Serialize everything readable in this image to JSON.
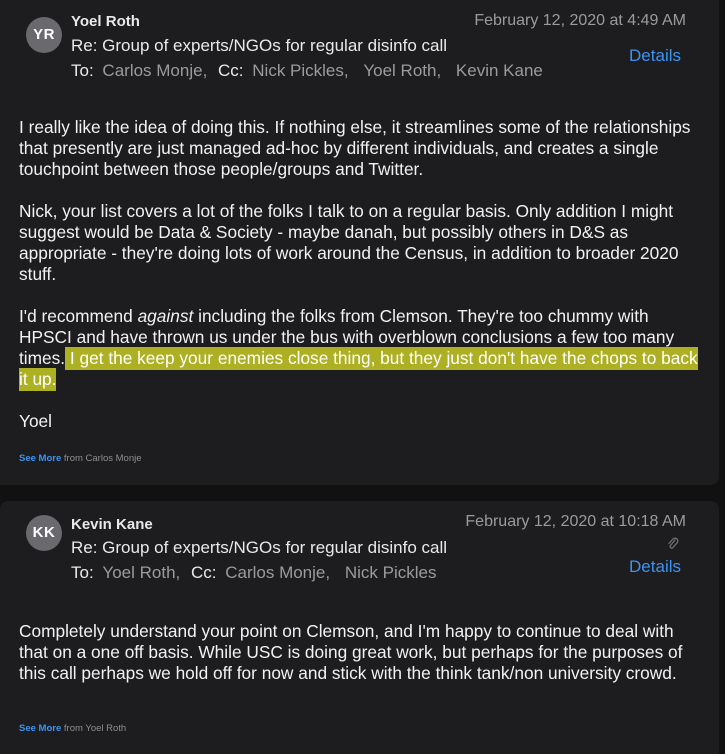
{
  "messages": [
    {
      "avatar_initials": "YR",
      "sender": "Yoel Roth",
      "date": "February 12, 2020 at 4:49 AM",
      "subject": "Re: Group of experts/NGOs for regular disinfo call",
      "to_label": "To:",
      "to": [
        "Carlos Monje,"
      ],
      "cc_label": "Cc:",
      "cc": [
        "Nick Pickles,",
        "Yoel Roth,",
        "Kevin Kane"
      ],
      "details_label": "Details",
      "body": {
        "p1": "I really like the idea of doing this. If nothing else, it streamlines some of the relationships that presently are just managed ad-hoc by different individuals, and creates a single touchpoint between those people/groups and Twitter.",
        "p2": "Nick, your list covers a lot of the folks I talk to on a regular basis. Only addition I might suggest would be Data & Society - maybe danah, but possibly others in D&S as appropriate - they're doing lots of work around the Census, in addition to broader 2020 stuff.",
        "p3_before": "I'd recommend ",
        "p3_emph": "against",
        "p3_middle": " including the folks from Clemson. They're too chummy with HPSCI and have thrown us under the bus with overblown conclusions a few too many times.",
        "p3_highlight": " I get the keep your enemies close thing, but they just don't have the chops to back it up.",
        "signoff": "Yoel"
      },
      "see_more_link": "See More",
      "see_more_from": " from Carlos Monje"
    },
    {
      "avatar_initials": "KK",
      "sender": "Kevin Kane",
      "date": "February 12, 2020 at 10:18 AM",
      "subject": "Re: Group of experts/NGOs for regular disinfo call",
      "to_label": "To:",
      "to": [
        "Yoel Roth,"
      ],
      "cc_label": "Cc:",
      "cc": [
        "Carlos Monje,",
        "Nick Pickles"
      ],
      "details_label": "Details",
      "attachment_icon": "paperclip-icon",
      "body": {
        "p1": "Completely understand your point on Clemson, and I'm happy to continue to deal with that on a one off basis.  While USC is doing great work, but perhaps for the purposes of this call perhaps we hold off for now and stick with the think tank/non university crowd."
      },
      "see_more_link": "See More",
      "see_more_from": " from Yoel Roth"
    }
  ],
  "colors": {
    "background": "#111111",
    "pane": "#1d1d1f",
    "link": "#3b94f2",
    "highlight": "#aeb023",
    "secondary_text": "#9b9b9f"
  }
}
